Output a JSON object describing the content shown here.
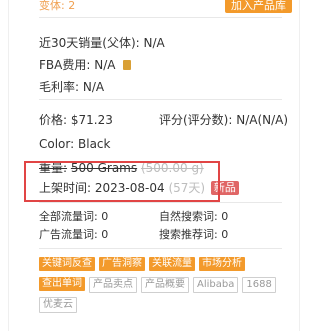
{
  "top": {
    "variant_text": "变体: 2",
    "add_button": "加入产品库"
  },
  "rows": {
    "sales_label": "近30天销量(父体):",
    "sales_value": "N/A",
    "fba_label": "FBA费用:",
    "fba_value": "N/A",
    "margin_label": "毛利率:",
    "margin_value": "N/A",
    "price_label": "价格:",
    "price_value": "$71.23",
    "rating_label": "评分(评分数):",
    "rating_value": "N/A(N/A)",
    "color_label": "Color:",
    "color_value": "Black",
    "weight_label": "重量:",
    "weight_value": "500 Grams",
    "weight_extra": "(500.00 g)",
    "launch_label": "上架时间:",
    "launch_value": "2023-08-04",
    "launch_days": "(57天)",
    "new_badge": "新品"
  },
  "keywords": {
    "all_traffic_label": "全部流量词:",
    "all_traffic_value": "0",
    "natural_search_label": "自然搜索词:",
    "natural_search_value": "0",
    "ad_traffic_label": "广告流量词:",
    "ad_traffic_value": "0",
    "search_recommend_label": "搜索推荐词:",
    "search_recommend_value": "0"
  },
  "tags": {
    "row1": [
      "关键词反查",
      "广告洞察",
      "关联流量",
      "市场分析"
    ],
    "row2": [
      "查出单词",
      "产品卖点",
      "产品概要",
      "Alibaba",
      "1688"
    ],
    "row3": [
      "优麦云"
    ]
  },
  "colors": {
    "accent": "#f39a2b",
    "highlight": "#e14545",
    "badge": "#e06666"
  }
}
